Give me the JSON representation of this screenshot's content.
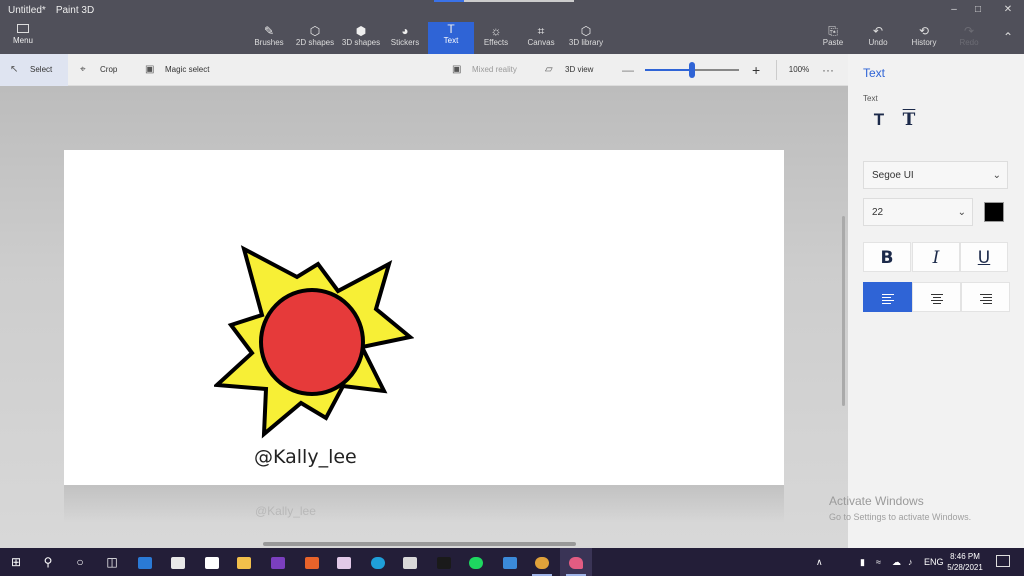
{
  "window": {
    "title": "Untitled*",
    "app_name": "Paint 3D",
    "minimize": "–",
    "maximize": "□",
    "close": "✕"
  },
  "menu": {
    "label": "Menu"
  },
  "ribbon": {
    "tools": [
      {
        "label": "Brushes",
        "icon": "✎"
      },
      {
        "label": "2D shapes",
        "icon": "⬡"
      },
      {
        "label": "3D shapes",
        "icon": "⬢"
      },
      {
        "label": "Stickers",
        "icon": "◕"
      },
      {
        "label": "Text",
        "icon": "T"
      },
      {
        "label": "Effects",
        "icon": "☼"
      },
      {
        "label": "Canvas",
        "icon": "⌗"
      },
      {
        "label": "3D library",
        "icon": "⬡"
      }
    ],
    "right": [
      {
        "label": "Paste",
        "icon": "⎘"
      },
      {
        "label": "Undo",
        "icon": "↶"
      },
      {
        "label": "History",
        "icon": "⟲"
      },
      {
        "label": "Redo",
        "icon": "↷"
      }
    ],
    "collapse_icon": "⌃"
  },
  "subtoolbar": {
    "select": "Select",
    "crop": "Crop",
    "magic_select": "Magic select",
    "mixed_reality": "Mixed reality",
    "view_3d": "3D view",
    "zoom_minus": "—",
    "zoom_plus": "+",
    "zoom_value": "100%",
    "zoom_level_percent": 100,
    "more": "···"
  },
  "canvas": {
    "credit_text": "@Kally_lee",
    "faded_text": "@Kally_lee"
  },
  "panel": {
    "title": "Text",
    "subtitle": "Text",
    "font": "Segoe UI",
    "size": "22",
    "color": "#000000",
    "bold": "B",
    "italic": "I",
    "underline": "U",
    "dropdown_chevron": "⌄"
  },
  "watermark": {
    "line1": "Activate Windows",
    "line2": "Go to Settings to activate Windows."
  },
  "taskbar": {
    "lang": "ENG",
    "time": "8:46 PM",
    "date": "5/28/2021",
    "tray_up": "∧"
  },
  "colors": {
    "accent": "#2f64d6",
    "sun_body": "#e63a3a",
    "sun_rays": "#f7ef36",
    "taskbar": "#231e38"
  }
}
